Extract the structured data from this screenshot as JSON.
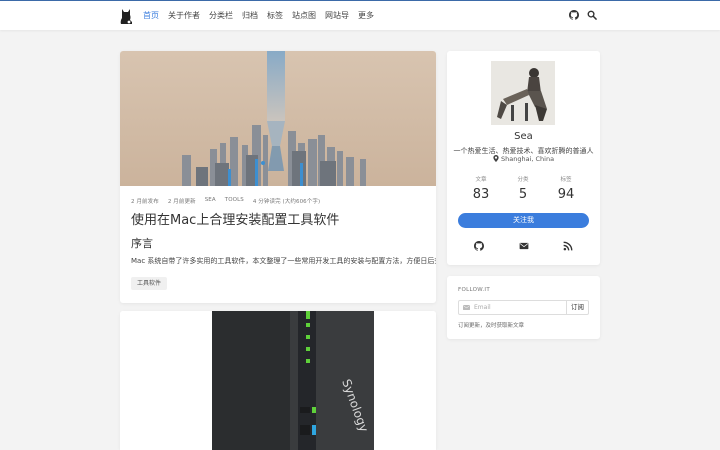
{
  "nav": {
    "items": [
      "首页",
      "关于作者",
      "分类栏",
      "归档",
      "标签",
      "站点图",
      "网站导",
      "更多"
    ],
    "active_index": 0,
    "right_icons": [
      "github-icon",
      "search-icon"
    ]
  },
  "posts": [
    {
      "meta": [
        "2 月前发布",
        "2 月前更新",
        "SEA",
        "TOOLS",
        "4 分钟读完 (大约606个字)"
      ],
      "title": "使用在Mac上合理安装配置工具软件",
      "subtitle": "序言",
      "excerpt": "Mac 系统自带了许多实用的工具软件，本文整理了一些常用开发工具的安装与配置方法，方便日后查阅与使用。",
      "tag": "工具软件"
    },
    {
      "cover_text": "Synology"
    }
  ],
  "profile": {
    "name": "Sea",
    "bio": "一个热爱生活、热爱技术、喜欢折腾的普通人",
    "location": "Shanghai, China",
    "stats": [
      {
        "label": "文章",
        "value": "83"
      },
      {
        "label": "分类",
        "value": "5"
      },
      {
        "label": "标签",
        "value": "94"
      }
    ],
    "follow_label": "关注我",
    "social_icons": [
      "github-icon",
      "email-icon",
      "rss-icon"
    ]
  },
  "followit": {
    "title": "FOLLOW.IT",
    "email_placeholder": "Email",
    "subscribe_label": "订阅",
    "note": "订阅更新，及时获取新文章"
  },
  "colors": {
    "accent": "#3b7ddd",
    "background": "#f3f3f3"
  }
}
